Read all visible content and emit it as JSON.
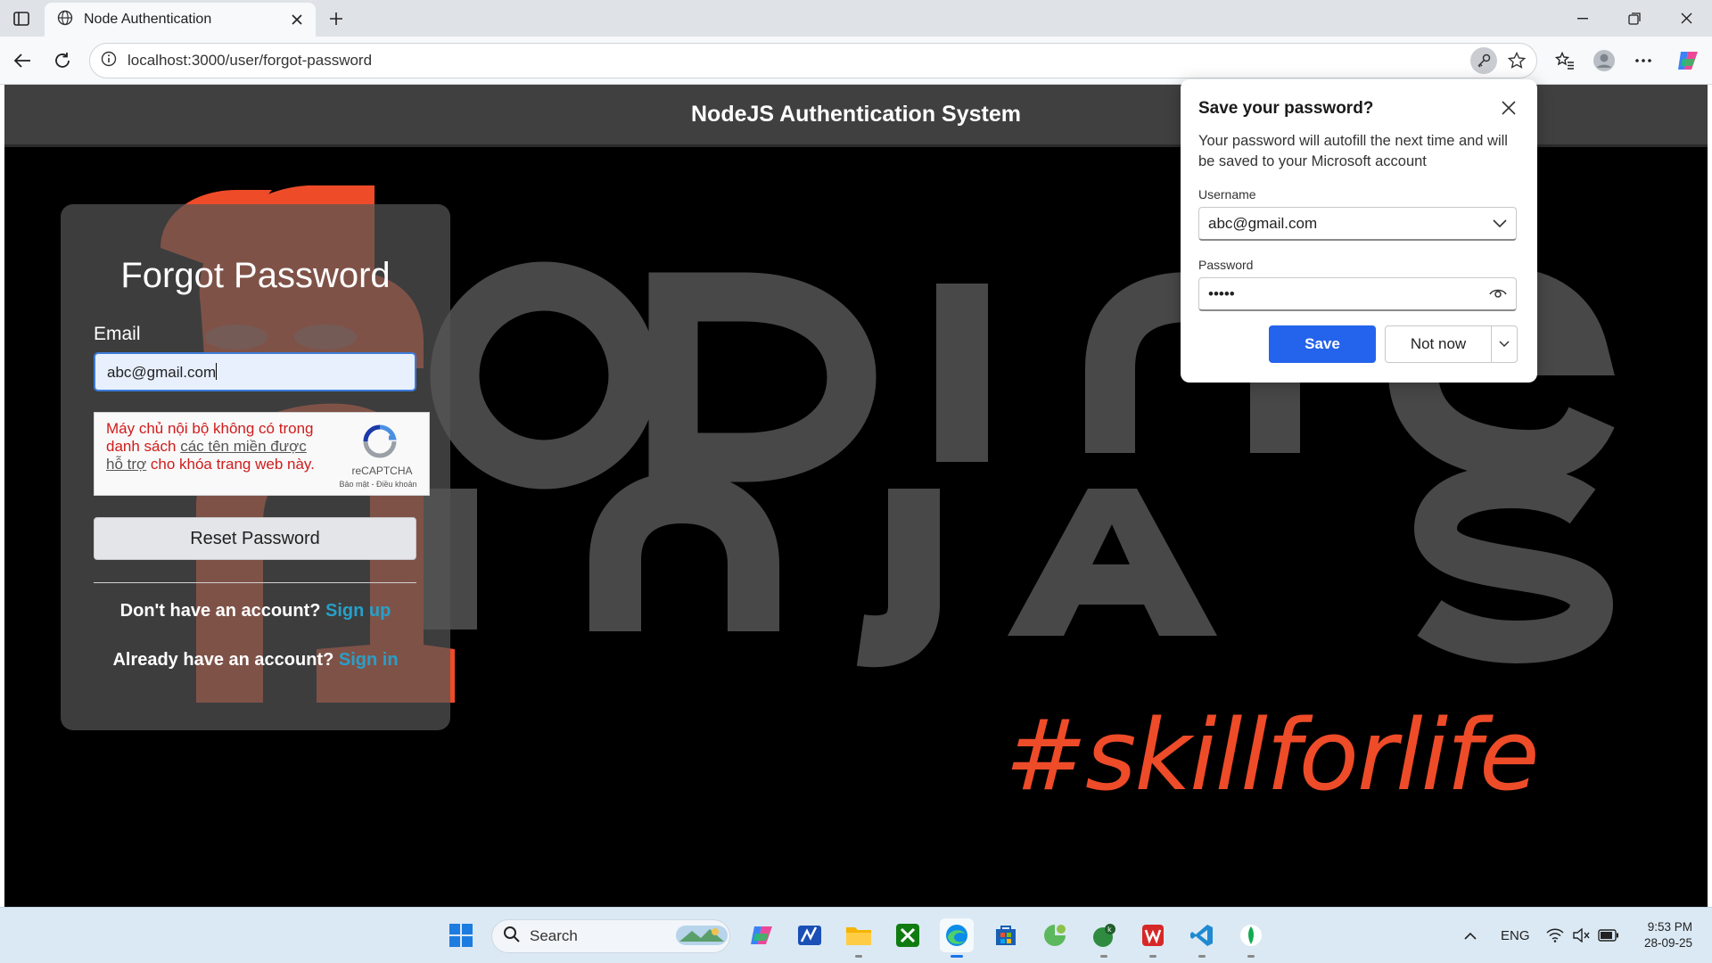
{
  "browser": {
    "tab_title": "Node Authentication",
    "url": "localhost:3000/user/forgot-password"
  },
  "site": {
    "header_title": "NodeJS Authentication System",
    "tagline": "#skillforlife"
  },
  "form": {
    "title": "Forgot Password",
    "email_label": "Email",
    "email_value": "abc@gmail.com",
    "captcha": {
      "error_text_1": "Máy chủ nội bộ không có trong danh sách ",
      "error_link": "các tên miền được hỗ trợ",
      "error_text_2": " cho khóa trang web này.",
      "brand": "reCAPTCHA",
      "terms": "Bảo mật - Điều khoản"
    },
    "reset_button": "Reset Password",
    "signup_prompt": "Don't have an account?",
    "signup_link": "Sign up",
    "signin_prompt": "Already have an account?",
    "signin_link": "Sign in"
  },
  "password_popup": {
    "title": "Save your password?",
    "description": "Your password will autofill the next time and will be saved to your Microsoft account",
    "username_label": "Username",
    "username_value": "abc@gmail.com",
    "password_label": "Password",
    "password_value": "•••••",
    "save_button": "Save",
    "not_now_button": "Not now"
  },
  "taskbar": {
    "search_label": "Search",
    "language": "ENG",
    "time": "9:53 PM",
    "date": "28-09-25"
  },
  "colors": {
    "accent_orange": "#ee4b29",
    "link_blue": "#27a0c9",
    "save_blue": "#2463eb"
  }
}
